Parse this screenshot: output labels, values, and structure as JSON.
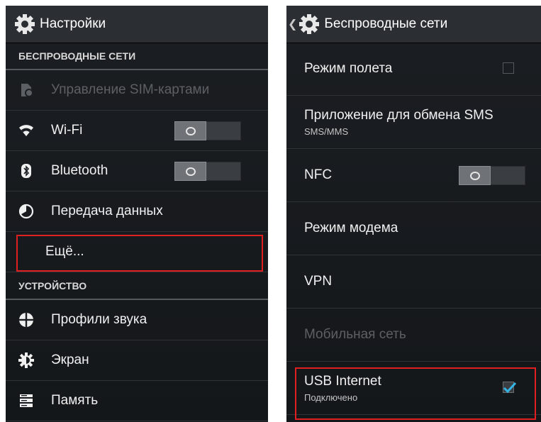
{
  "left": {
    "title": "Настройки",
    "section_wireless": "БЕСПРОВОДНЫЕ СЕТИ",
    "items_wireless": [
      {
        "label": "Управление SIM-картами",
        "icon": "sim-card-icon",
        "disabled": true
      },
      {
        "label": "Wi-Fi",
        "icon": "wifi-icon",
        "toggle": "off"
      },
      {
        "label": "Bluetooth",
        "icon": "bluetooth-icon",
        "toggle": "off"
      },
      {
        "label": "Передача данных",
        "icon": "data-usage-icon"
      },
      {
        "label": "Ещё..."
      }
    ],
    "section_device": "УСТРОЙСТВО",
    "items_device": [
      {
        "label": "Профили звука",
        "icon": "sound-profiles-icon"
      },
      {
        "label": "Экран",
        "icon": "display-icon"
      },
      {
        "label": "Память",
        "icon": "storage-icon"
      }
    ]
  },
  "right": {
    "title": "Беспроводные сети",
    "items": [
      {
        "label": "Режим полета",
        "checkbox": false
      },
      {
        "label": "Приложение для обмена SMS",
        "sub": "SMS/MMS"
      },
      {
        "label": "NFC",
        "toggle": "off"
      },
      {
        "label": "Режим модема"
      },
      {
        "label": "VPN"
      },
      {
        "label": "Мобильная сеть",
        "disabled": true
      },
      {
        "label": "USB Internet",
        "sub": "Подключено",
        "checkbox": true
      }
    ]
  },
  "colors": {
    "highlight": "#e02020",
    "check_accent": "#33b5e5",
    "background": "#16191c"
  }
}
